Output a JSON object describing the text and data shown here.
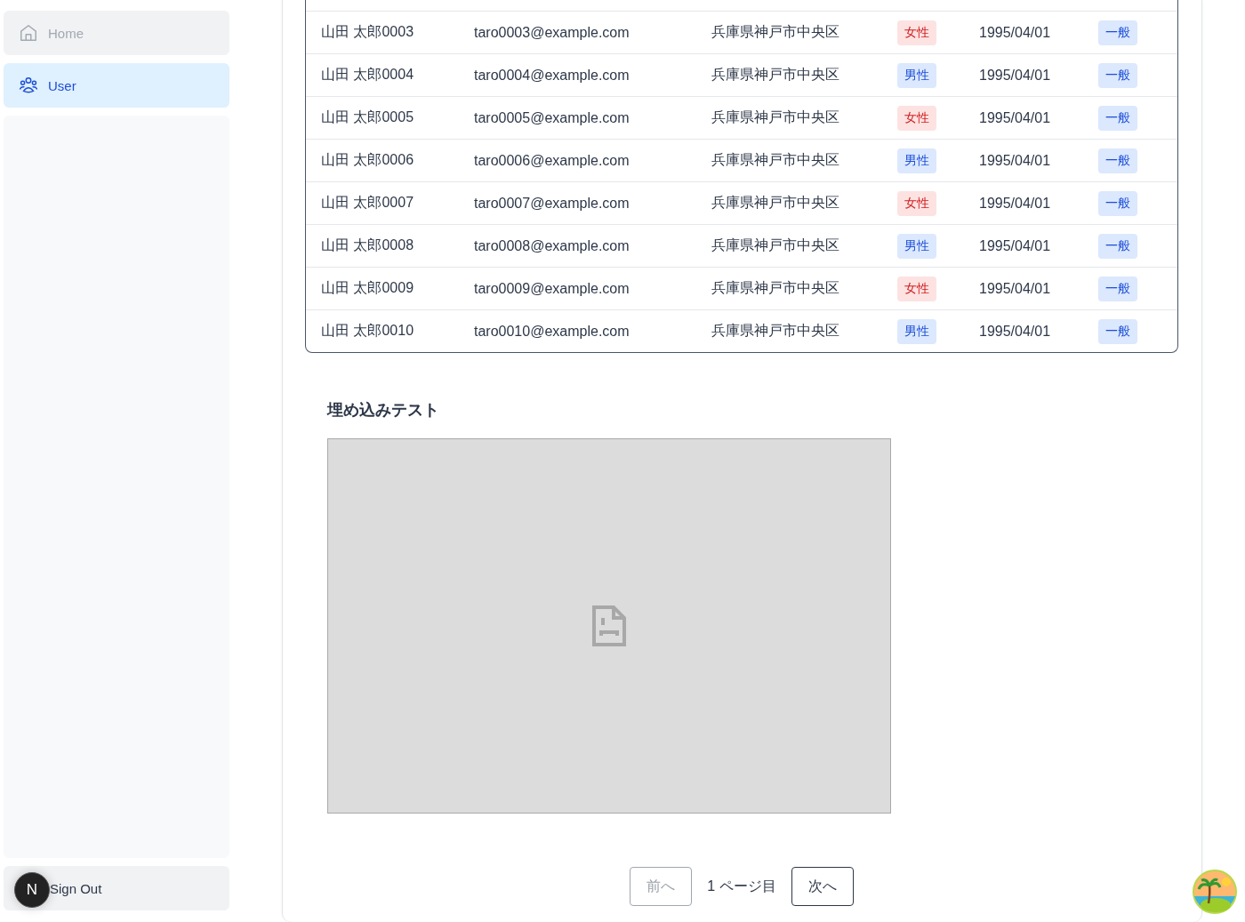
{
  "sidebar": {
    "items": [
      {
        "label": "Home",
        "kind": "home",
        "disabled": true,
        "selected": false
      },
      {
        "label": "User",
        "kind": "users",
        "disabled": false,
        "selected": true
      }
    ],
    "sign_out": {
      "label": "Sign Out"
    },
    "dev_badge": {
      "label": "N"
    }
  },
  "table": {
    "rows": [
      {
        "name": "山田 太郎0003",
        "email": "taro0003@example.com",
        "address": "兵庫県神戸市中央区",
        "gender": {
          "label": "女性",
          "kind": "female"
        },
        "birthday": "1995/04/01",
        "role": "一般"
      },
      {
        "name": "山田 太郎0004",
        "email": "taro0004@example.com",
        "address": "兵庫県神戸市中央区",
        "gender": {
          "label": "男性",
          "kind": "male"
        },
        "birthday": "1995/04/01",
        "role": "一般"
      },
      {
        "name": "山田 太郎0005",
        "email": "taro0005@example.com",
        "address": "兵庫県神戸市中央区",
        "gender": {
          "label": "女性",
          "kind": "female"
        },
        "birthday": "1995/04/01",
        "role": "一般"
      },
      {
        "name": "山田 太郎0006",
        "email": "taro0006@example.com",
        "address": "兵庫県神戸市中央区",
        "gender": {
          "label": "男性",
          "kind": "male"
        },
        "birthday": "1995/04/01",
        "role": "一般"
      },
      {
        "name": "山田 太郎0007",
        "email": "taro0007@example.com",
        "address": "兵庫県神戸市中央区",
        "gender": {
          "label": "女性",
          "kind": "female"
        },
        "birthday": "1995/04/01",
        "role": "一般"
      },
      {
        "name": "山田 太郎0008",
        "email": "taro0008@example.com",
        "address": "兵庫県神戸市中央区",
        "gender": {
          "label": "男性",
          "kind": "male"
        },
        "birthday": "1995/04/01",
        "role": "一般"
      },
      {
        "name": "山田 太郎0009",
        "email": "taro0009@example.com",
        "address": "兵庫県神戸市中央区",
        "gender": {
          "label": "女性",
          "kind": "female"
        },
        "birthday": "1995/04/01",
        "role": "一般"
      },
      {
        "name": "山田 太郎0010",
        "email": "taro0010@example.com",
        "address": "兵庫県神戸市中央区",
        "gender": {
          "label": "男性",
          "kind": "male"
        },
        "birthday": "1995/04/01",
        "role": "一般"
      }
    ]
  },
  "embed": {
    "heading": "埋め込みテスト"
  },
  "pagination": {
    "prev": {
      "label": "前へ",
      "disabled": true
    },
    "page": "1 ページ目",
    "next": {
      "label": "次へ",
      "disabled": false
    }
  }
}
